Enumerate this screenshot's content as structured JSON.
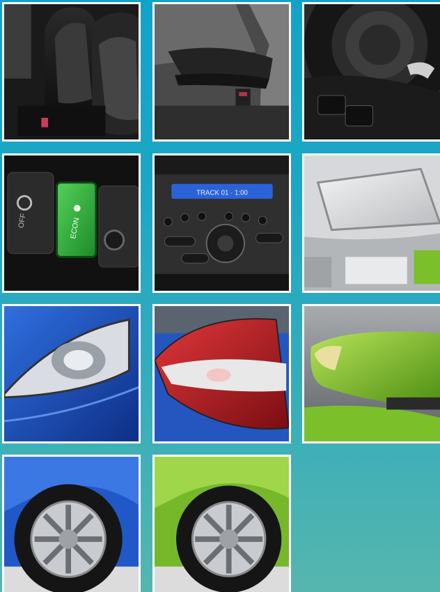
{
  "gallery": {
    "tiles": [
      {
        "subject": "seats-icon"
      },
      {
        "subject": "armrest-icon"
      },
      {
        "subject": "steering-wheel-icon"
      },
      {
        "subject": "econ-button-icon",
        "labels": {
          "vsa": "OFF",
          "econ": "ECON"
        }
      },
      {
        "subject": "audio-system-icon",
        "labels": {
          "display": "TRACK 01 ·  1:00"
        }
      },
      {
        "subject": "sunroof-icon"
      },
      {
        "subject": "headlight-icon"
      },
      {
        "subject": "taillight-icon"
      },
      {
        "subject": "side-mirror-icon"
      },
      {
        "subject": "blue-wheel-icon"
      },
      {
        "subject": "green-wheel-icon"
      }
    ]
  },
  "colors": {
    "background_top": "#11a3c7",
    "background_bottom": "#56b6ae",
    "frame": "#ffffff",
    "car_blue": "#1d4fb5",
    "car_green": "#7bbf2a",
    "econ_green": "#2fa83a",
    "display_blue": "#2a62d8"
  }
}
